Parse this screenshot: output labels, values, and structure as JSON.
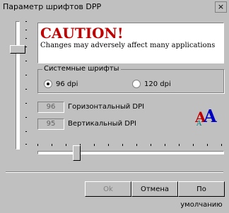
{
  "window": {
    "title": "Параметр шрифтов DPP",
    "close_glyph": "×"
  },
  "caution": {
    "title": "CAUTION!",
    "text": "Changes may adversely affect many applications"
  },
  "group": {
    "label": "Системные шрифты",
    "options": [
      {
        "label": "96 dpi",
        "selected": true
      },
      {
        "label": "120 dpi",
        "selected": false
      }
    ]
  },
  "fields": [
    {
      "value": "96",
      "label": "Горизонтальный DPI"
    },
    {
      "value": "95",
      "label": "Вертикальный DPI"
    }
  ],
  "buttons": {
    "ok": "Ok",
    "cancel": "Отмена",
    "default": "По умолчанию"
  },
  "icons": {
    "font_icon": "aa-font-icon"
  },
  "colors": {
    "caution_red": "#c00000",
    "face": "#c0c0c0"
  }
}
